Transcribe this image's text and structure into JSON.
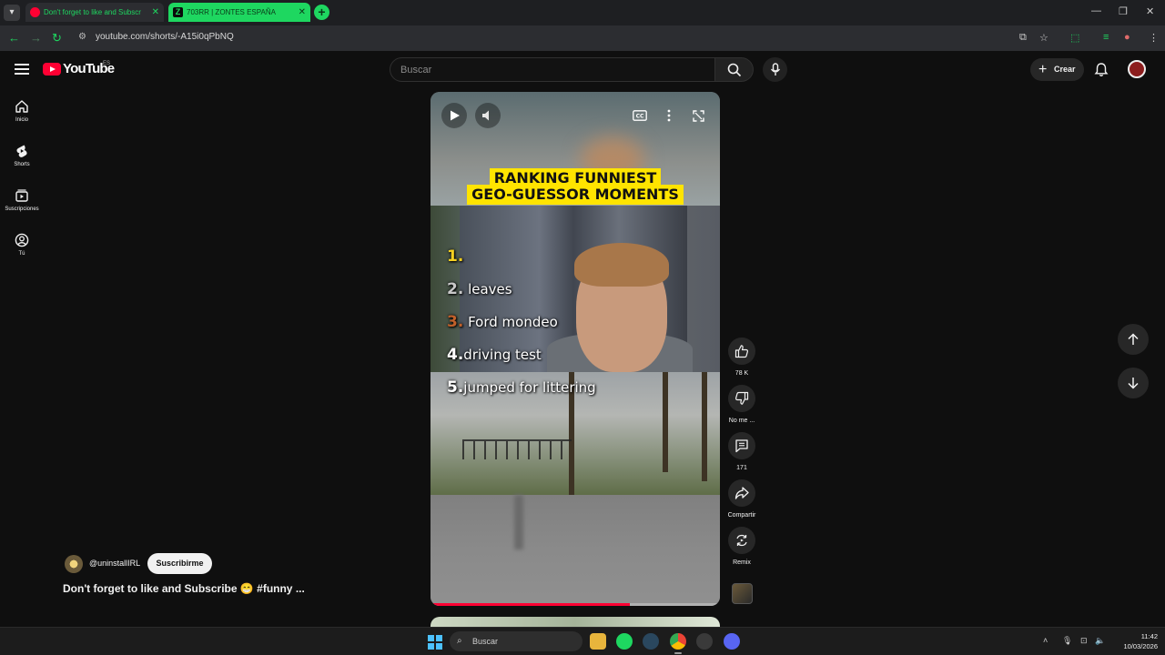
{
  "browser": {
    "tabs": [
      {
        "title": "Don't forget to like and Subscr",
        "active": false
      },
      {
        "title": "703RR | ZONTES ESPAÑA",
        "active": true
      }
    ],
    "url": "youtube.com/shorts/-A15i0qPbNQ",
    "accent_color": "#1ed760"
  },
  "youtube": {
    "logo_text": "YouTube",
    "country_code": "ES",
    "search_placeholder": "Buscar",
    "create_label": "Crear",
    "sidebar": [
      {
        "label": "Inicio",
        "icon": "home-icon"
      },
      {
        "label": "Shorts",
        "icon": "shorts-icon"
      },
      {
        "label": "Suscripciones",
        "icon": "subscriptions-icon"
      },
      {
        "label": "Tú",
        "icon": "you-icon"
      }
    ],
    "short": {
      "banner_line1": "RANKING FUNNIEST",
      "banner_line2": "GEO-GUESSOR MOMENTS",
      "ranking": [
        {
          "num": "1.",
          "text": ""
        },
        {
          "num": "2.",
          "text": "leaves"
        },
        {
          "num": "3.",
          "text": "Ford mondeo"
        },
        {
          "num": "4.",
          "text": "driving test"
        },
        {
          "num": "5.",
          "text": "jumped for littering"
        }
      ],
      "progress_fraction": 0.69
    },
    "actions": {
      "likes": "78 K",
      "dislike_label": "No me ...",
      "comments": "171",
      "share_label": "Compartir",
      "remix_label": "Remix"
    },
    "channel": {
      "handle": "@uninstallIRL",
      "subscribe_label": "Suscribirme",
      "video_title": "Don't forget to like and Subscribe 😁 #funny ..."
    }
  },
  "taskbar": {
    "search_label": "Buscar",
    "time": "11:42",
    "date": "10/03/2026"
  }
}
